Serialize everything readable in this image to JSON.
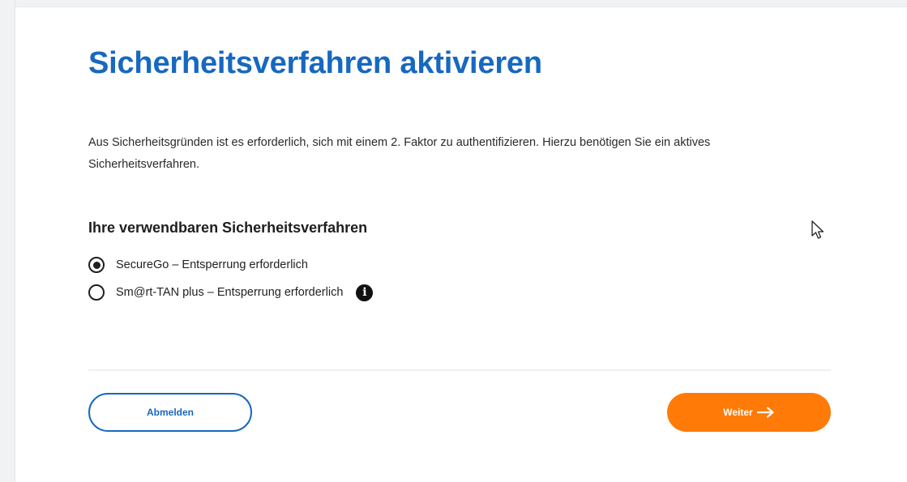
{
  "page": {
    "title": "Sicherheitsverfahren aktivieren",
    "intro_text": "Aus Sicherheitsgründen ist es erforderlich, sich mit einem 2. Faktor zu authentifizieren. Hierzu benötigen Sie ein aktives Sicherheitsverfahren.",
    "section_heading": "Ihre verwendbaren Sicherheitsverfahren"
  },
  "options": [
    {
      "label": "SecureGo – Entsperrung erforderlich",
      "selected": true
    },
    {
      "label": "Sm@rt-TAN plus – Entsperrung erforderlich",
      "selected": false,
      "has_info_icon": true
    }
  ],
  "info_icon": {
    "glyph": "i",
    "name": "info-icon"
  },
  "buttons": {
    "logout_label": "Abmelden",
    "next_label": "Weiter"
  },
  "colors": {
    "title": "#1768c0",
    "primary_button": "#ff7a06",
    "secondary_button_border": "#1768c0"
  },
  "icons": {
    "next_arrow": "arrow-right-icon",
    "cursor": "mouse-pointer-icon"
  }
}
